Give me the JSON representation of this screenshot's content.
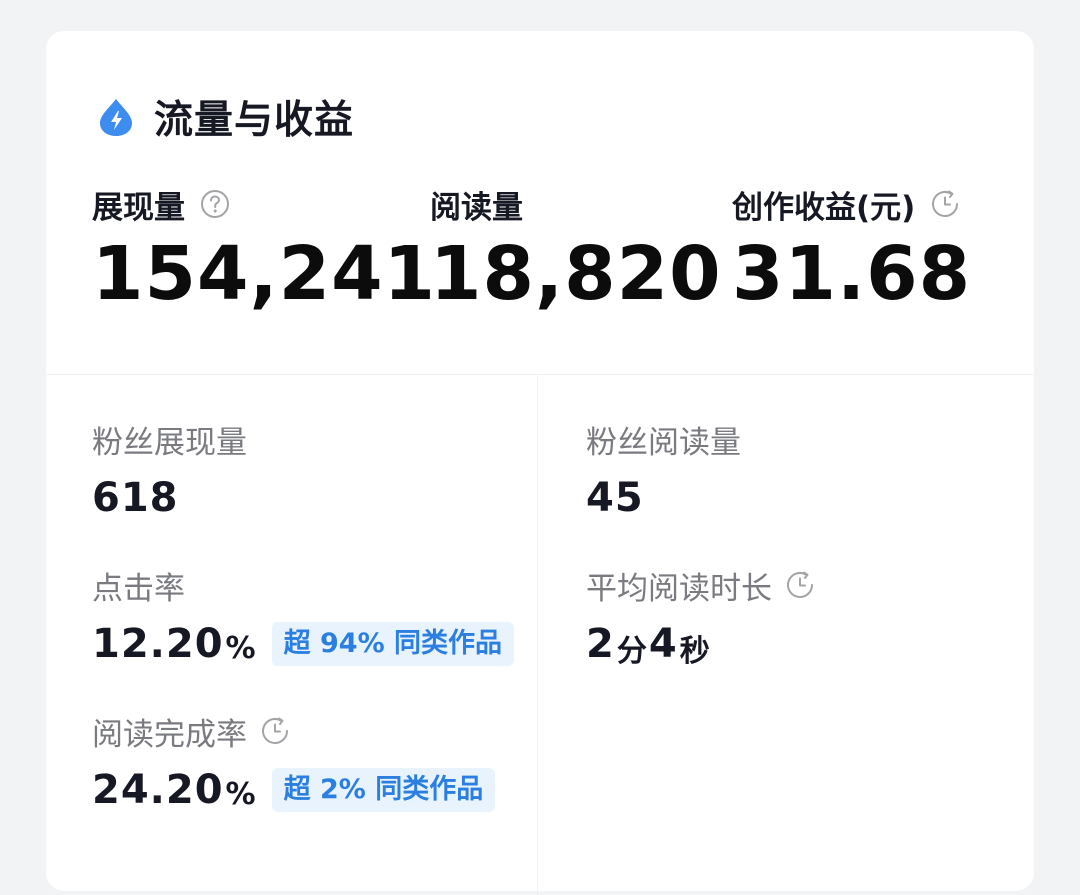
{
  "header": {
    "title": "流量与收益",
    "icon": "lightning-drop-icon",
    "accent_color": "#3d8cf0"
  },
  "metrics": [
    {
      "label": "展现量",
      "value": "154,241",
      "icon": "question-circle-icon"
    },
    {
      "label": "阅读量",
      "value": "18,820"
    },
    {
      "label": "创作收益(元)",
      "value": "31.68",
      "icon": "clock-icon"
    }
  ],
  "details": {
    "fan_impressions": {
      "label": "粉丝展现量",
      "value": "618"
    },
    "fan_reads": {
      "label": "粉丝阅读量",
      "value": "45"
    },
    "click_rate": {
      "label": "点击率",
      "value": "12.20",
      "unit": "%",
      "badge": "超 94% 同类作品"
    },
    "avg_read_time": {
      "label": "平均阅读时长",
      "minutes": "2",
      "minutes_unit": "分",
      "seconds": "4",
      "seconds_unit": "秒",
      "icon": "clock-icon"
    },
    "completion_rate": {
      "label": "阅读完成率",
      "value": "24.20",
      "unit": "%",
      "badge": "超 2% 同类作品",
      "icon": "clock-icon"
    }
  },
  "colors": {
    "badge_bg": "#e9f3fd",
    "badge_text": "#2a7fe0",
    "label_gray": "#7a7b80"
  }
}
